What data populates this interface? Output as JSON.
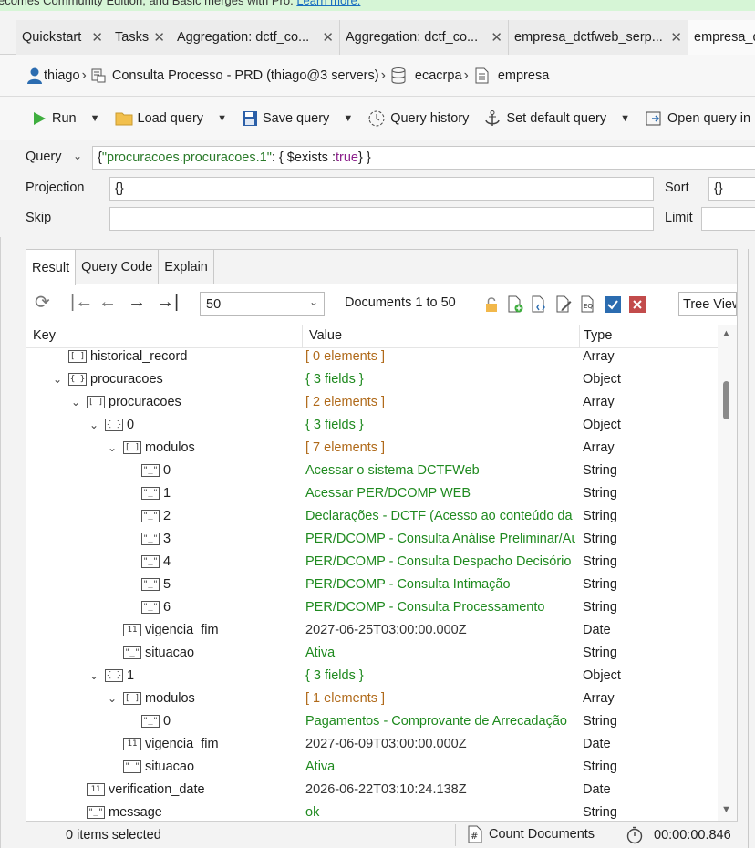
{
  "banner": {
    "text": "ecomes Community Edition, and Basic merges with Pro.",
    "link": "Learn more."
  },
  "tabs": [
    {
      "label": "Quickstart"
    },
    {
      "label": "Tasks"
    },
    {
      "label": "Aggregation: dctf_co..."
    },
    {
      "label": "Aggregation: dctf_co..."
    },
    {
      "label": "empresa_dctfweb_serp..."
    },
    {
      "label": "empresa_d"
    }
  ],
  "breadcrumb": {
    "user": "thiago",
    "connection": "Consulta Processo - PRD (thiago@3 servers)",
    "database": "ecacrpa",
    "collection": "empresa"
  },
  "toolbar": {
    "run": "Run",
    "load_query": "Load query",
    "save_query": "Save query",
    "query_history": "Query history",
    "set_default_query": "Set default query",
    "open_query_in": "Open query in"
  },
  "query": {
    "label": "Query",
    "open": "{ ",
    "field": "\"procuracoes.procuracoes.1\"",
    "mid": " : { $exists : ",
    "bool": "true",
    "close": " } }",
    "projection_label": "Projection",
    "projection_value": "{}",
    "sort_label": "Sort",
    "sort_value": "{}",
    "skip_label": "Skip",
    "skip_value": "",
    "limit_label": "Limit",
    "limit_value": ""
  },
  "result_tabs": [
    "Result",
    "Query Code",
    "Explain"
  ],
  "pagination": {
    "page_size": "50",
    "documents_label": "Documents 1 to 50",
    "view_mode": "Tree View"
  },
  "columns": {
    "key": "Key",
    "value": "Value",
    "type": "Type"
  },
  "rows": [
    {
      "key": "historical_record",
      "icon": "[ ]",
      "value": "[ 0 elements ]",
      "vclass": "v-count",
      "type": "Array",
      "indent": 0,
      "toggle": ""
    },
    {
      "key": "procuracoes",
      "icon": "{ }",
      "value": "{ 3 fields }",
      "vclass": "v-obj",
      "type": "Object",
      "indent": 0,
      "toggle": "v"
    },
    {
      "key": "procuracoes",
      "icon": "[ ]",
      "value": "[ 2 elements ]",
      "vclass": "v-count",
      "type": "Array",
      "indent": 1,
      "toggle": "v"
    },
    {
      "key": "0",
      "icon": "{ }",
      "value": "{ 3 fields }",
      "vclass": "v-obj",
      "type": "Object",
      "indent": 2,
      "toggle": "v"
    },
    {
      "key": "modulos",
      "icon": "[ ]",
      "value": "[ 7 elements ]",
      "vclass": "v-count",
      "type": "Array",
      "indent": 3,
      "toggle": "v"
    },
    {
      "key": "0",
      "icon": "\"_\"",
      "value": "Acessar o sistema DCTFWeb",
      "vclass": "v-string",
      "type": "String",
      "indent": 4,
      "toggle": ""
    },
    {
      "key": "1",
      "icon": "\"_\"",
      "value": "Acessar PER/DCOMP WEB",
      "vclass": "v-string",
      "type": "String",
      "indent": 4,
      "toggle": ""
    },
    {
      "key": "2",
      "icon": "\"_\"",
      "value": "Declarações - DCTF (Acesso ao conteúdo da",
      "vclass": "v-string",
      "type": "String",
      "indent": 4,
      "toggle": ""
    },
    {
      "key": "3",
      "icon": "\"_\"",
      "value": "PER/DCOMP - Consulta Análise Preliminar/Au",
      "vclass": "v-string",
      "type": "String",
      "indent": 4,
      "toggle": ""
    },
    {
      "key": "4",
      "icon": "\"_\"",
      "value": "PER/DCOMP - Consulta Despacho Decisório",
      "vclass": "v-string",
      "type": "String",
      "indent": 4,
      "toggle": ""
    },
    {
      "key": "5",
      "icon": "\"_\"",
      "value": "PER/DCOMP - Consulta Intimação",
      "vclass": "v-string",
      "type": "String",
      "indent": 4,
      "toggle": ""
    },
    {
      "key": "6",
      "icon": "\"_\"",
      "value": "PER/DCOMP - Consulta Processamento",
      "vclass": "v-string",
      "type": "String",
      "indent": 4,
      "toggle": ""
    },
    {
      "key": "vigencia_fim",
      "icon": "11",
      "value": "2027-06-25T03:00:00.000Z",
      "vclass": "v-date",
      "type": "Date",
      "indent": 3,
      "toggle": ""
    },
    {
      "key": "situacao",
      "icon": "\"_\"",
      "value": "Ativa",
      "vclass": "v-string",
      "type": "String",
      "indent": 3,
      "toggle": ""
    },
    {
      "key": "1",
      "icon": "{ }",
      "value": "{ 3 fields }",
      "vclass": "v-obj",
      "type": "Object",
      "indent": 2,
      "toggle": "v"
    },
    {
      "key": "modulos",
      "icon": "[ ]",
      "value": "[ 1 elements ]",
      "vclass": "v-count",
      "type": "Array",
      "indent": 3,
      "toggle": "v"
    },
    {
      "key": "0",
      "icon": "\"_\"",
      "value": "Pagamentos - Comprovante de Arrecadação",
      "vclass": "v-string",
      "type": "String",
      "indent": 4,
      "toggle": ""
    },
    {
      "key": "vigencia_fim",
      "icon": "11",
      "value": "2027-06-09T03:00:00.000Z",
      "vclass": "v-date",
      "type": "Date",
      "indent": 3,
      "toggle": ""
    },
    {
      "key": "situacao",
      "icon": "\"_\"",
      "value": "Ativa",
      "vclass": "v-string",
      "type": "String",
      "indent": 3,
      "toggle": ""
    },
    {
      "key": "verification_date",
      "icon": "11",
      "value": "2026-06-22T03:10:24.138Z",
      "vclass": "v-date",
      "type": "Date",
      "indent": 1,
      "toggle": ""
    },
    {
      "key": "message",
      "icon": "\"_\"",
      "value": "ok",
      "vclass": "v-string",
      "type": "String",
      "indent": 1,
      "toggle": ""
    }
  ],
  "status": {
    "selected": "0 items selected",
    "count_documents": "Count Documents",
    "elapsed": "00:00:00.846"
  }
}
